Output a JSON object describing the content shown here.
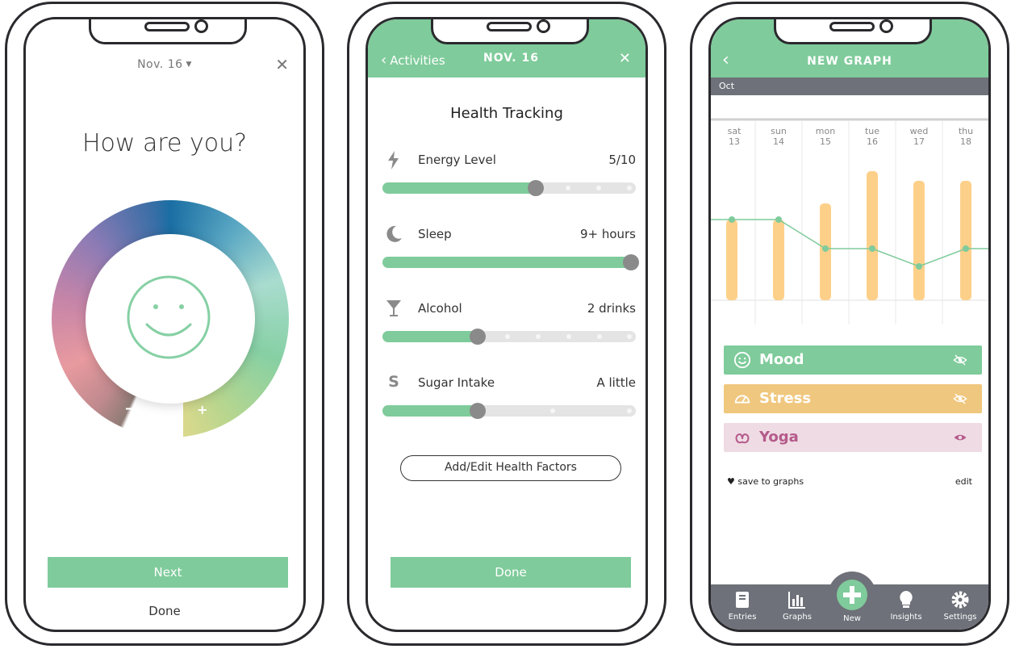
{
  "phone1": {
    "date": "Nov. 16",
    "question": "How are you?",
    "wheel_minus": "−",
    "wheel_plus": "+",
    "next_label": "Next",
    "done_label": "Done"
  },
  "phone2": {
    "back_label": "Activities",
    "title": "NOV. 16",
    "section_title": "Health Tracking",
    "factors": [
      {
        "icon": "lightning-icon",
        "name": "Energy Level",
        "value": "5/10",
        "level": 0.6
      },
      {
        "icon": "moon-icon",
        "name": "Sleep",
        "value": "9+ hours",
        "level": 1.0
      },
      {
        "icon": "cocktail-icon",
        "name": "Alcohol",
        "value": "2 drinks",
        "level": 0.375
      },
      {
        "icon": "sugar-s-icon",
        "name": "Sugar Intake",
        "value": "A little",
        "level": 0.375,
        "icon_text": "S"
      }
    ],
    "edit_label": "Add/Edit Health Factors",
    "done_label": "Done"
  },
  "phone3": {
    "title": "NEW GRAPH",
    "month": "Oct",
    "days": [
      {
        "dow": "sat",
        "num": "13"
      },
      {
        "dow": "sun",
        "num": "14"
      },
      {
        "dow": "mon",
        "num": "15"
      },
      {
        "dow": "tue",
        "num": "16"
      },
      {
        "dow": "wed",
        "num": "17"
      },
      {
        "dow": "thu",
        "num": "18"
      }
    ],
    "chart_data": {
      "type": "bar",
      "categories": [
        "sat 13",
        "sun 14",
        "mon 15",
        "tue 16",
        "wed 17",
        "thu 18"
      ],
      "series": [
        {
          "name": "Stress",
          "type": "bar",
          "values": [
            5,
            5,
            6,
            8,
            7.4,
            7.4
          ]
        },
        {
          "name": "Mood",
          "type": "line",
          "values": [
            5,
            5,
            3.2,
            3.2,
            2.1,
            3.2
          ]
        }
      ],
      "ylim": [
        0,
        10
      ]
    },
    "legend": [
      {
        "name": "Mood",
        "icon": "smiley-icon",
        "visibility": "eye-slash-icon"
      },
      {
        "name": "Stress",
        "icon": "gauge-icon",
        "visibility": "eye-slash-icon"
      },
      {
        "name": "Yoga",
        "icon": "pretzel-icon",
        "visibility": "eye-icon"
      }
    ],
    "save_label": "save to graphs",
    "edit_label": "edit",
    "tabs": [
      "Entries",
      "Graphs",
      "New",
      "Insights",
      "Settings"
    ]
  },
  "colors": {
    "green": "#7fcb9b",
    "bar_orange": "#fdd08a",
    "stress_orange": "#f0c77e",
    "yoga_pink": "#efdbe4",
    "yoga_text": "#b45a8a",
    "tabbar_gray": "#6e7179"
  }
}
